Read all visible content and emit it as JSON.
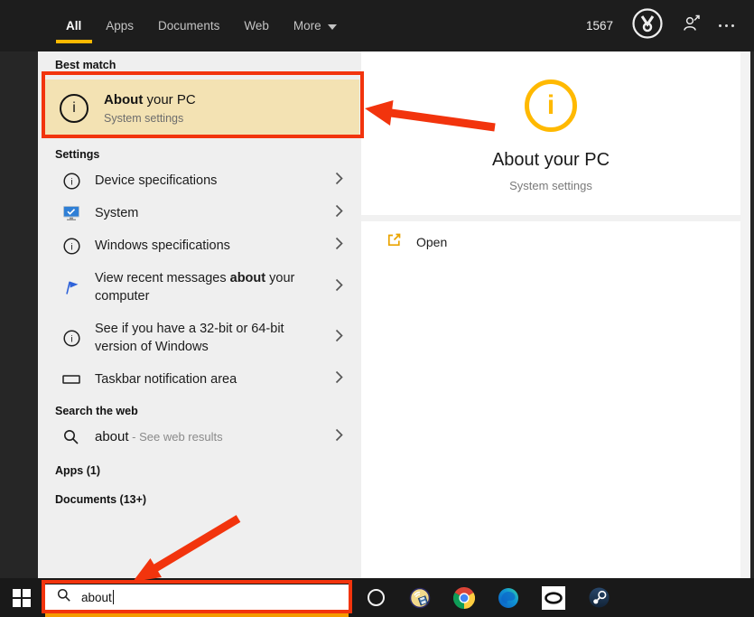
{
  "topbar": {
    "tabs": [
      {
        "label": "All",
        "active": true
      },
      {
        "label": "Apps",
        "active": false
      },
      {
        "label": "Documents",
        "active": false
      },
      {
        "label": "Web",
        "active": false
      },
      {
        "label": "More",
        "active": false,
        "dropdown": true
      }
    ],
    "rewards_points": "1567",
    "icons": [
      "rewards-medal-icon",
      "account-icon",
      "ellipsis-icon"
    ]
  },
  "left_panel": {
    "best_match": {
      "header": "Best match",
      "item": {
        "icon": "info-icon",
        "title_bold": "About",
        "title_rest": " your PC",
        "subtitle": "System settings"
      }
    },
    "settings": {
      "header": "Settings",
      "items": [
        {
          "icon": "info-icon",
          "text": "Device specifications"
        },
        {
          "icon": "system-monitor-icon",
          "text": "System"
        },
        {
          "icon": "info-icon",
          "text": "Windows specifications"
        },
        {
          "icon": "flag-icon",
          "text_prefix": "View recent messages ",
          "text_bold": "about",
          "text_suffix": " your computer"
        },
        {
          "icon": "info-icon",
          "text": "See if you have a 32-bit or 64-bit version of Windows"
        },
        {
          "icon": "taskbar-area-icon",
          "text": "Taskbar notification area"
        }
      ]
    },
    "search_web": {
      "header": "Search the web",
      "item": {
        "icon": "search-icon",
        "query": "about",
        "separator": " - ",
        "hint": "See web results"
      }
    },
    "apps_header": "Apps (1)",
    "documents_header": "Documents (13+)"
  },
  "right_panel": {
    "icon": "info-circle-icon",
    "title": "About your PC",
    "subtitle": "System settings",
    "open_action": {
      "icon": "open-external-icon",
      "label": "Open"
    }
  },
  "taskbar": {
    "start_icon": "windows-start-icon",
    "search": {
      "icon": "search-icon",
      "value": "about"
    },
    "app_icons": [
      "cortana-ring-icon",
      "media-app-icon",
      "chrome-icon",
      "edge-icon",
      "oculus-icon",
      "steam-icon"
    ]
  },
  "annotations": {
    "boxes": [
      "best-match-highlight-box",
      "taskbar-search-highlight-box"
    ],
    "arrows": [
      "arrow-to-best-match",
      "arrow-to-search-box"
    ]
  },
  "colors": {
    "annotation_red": "#f2340d",
    "accent_gold": "#ffb900",
    "best_match_bg": "#f3e2b3",
    "topbar_bg": "#1d1d1d",
    "taskbar_bg": "#191919",
    "left_panel_bg": "#efefef",
    "right_panel_bg": "#ffffff"
  }
}
